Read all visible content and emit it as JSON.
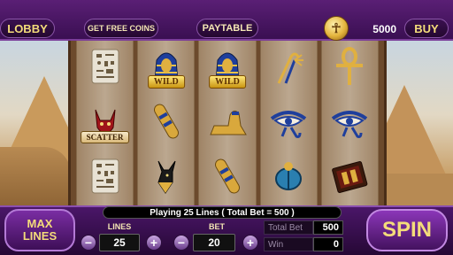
{
  "header": {
    "lobby_label": "LOBBY",
    "free_coins_label": "GET FREE COINS",
    "paytable_label": "PAYTABLE",
    "coin_icon": "coin-icon",
    "balance": "5000",
    "buy_label": "BUY"
  },
  "reels": [
    [
      {
        "icon": "hieroglyph-tablet-icon",
        "label": ""
      },
      {
        "icon": "bastet-cat-icon",
        "label": "SCATTER"
      },
      {
        "icon": "hieroglyph-tablet-icon",
        "label": ""
      }
    ],
    [
      {
        "icon": "pharaoh-mask-icon",
        "label": "WILD"
      },
      {
        "icon": "sarcophagus-icon",
        "label": ""
      },
      {
        "icon": "anubis-icon",
        "label": ""
      }
    ],
    [
      {
        "icon": "pharaoh-mask-icon",
        "label": "WILD"
      },
      {
        "icon": "sphinx-icon",
        "label": ""
      },
      {
        "icon": "sarcophagus-icon",
        "label": ""
      }
    ],
    [
      {
        "icon": "crook-flail-icon",
        "label": ""
      },
      {
        "icon": "eye-of-horus-icon",
        "label": ""
      },
      {
        "icon": "scarab-icon",
        "label": ""
      }
    ],
    [
      {
        "icon": "ankh-icon",
        "label": ""
      },
      {
        "icon": "eye-of-horus-icon",
        "label": ""
      },
      {
        "icon": "book-icon",
        "label": ""
      }
    ]
  ],
  "footer": {
    "info_text": "Playing 25 Lines ( Total Bet = 500 )",
    "max_lines_label": "MAX LINES",
    "lines_label": "LINES",
    "lines_value": "25",
    "bet_label": "BET",
    "bet_value": "20",
    "minus_symbol": "−",
    "plus_symbol": "+",
    "total_bet_label": "Total Bet",
    "total_bet_value": "500",
    "win_label": "Win",
    "win_value": "0",
    "spin_label": "SPIN"
  },
  "colors": {
    "accent": "#f4dc7a",
    "panel": "#4a1668"
  }
}
